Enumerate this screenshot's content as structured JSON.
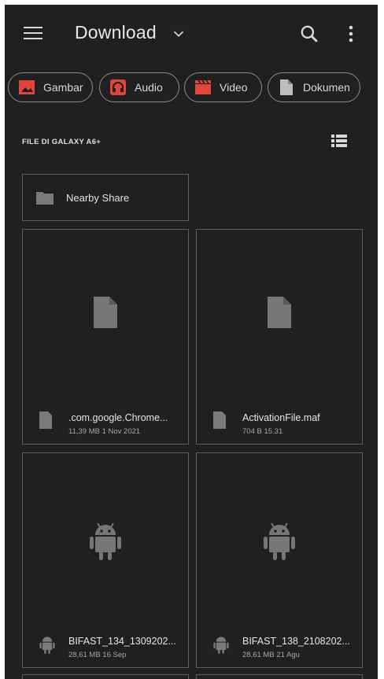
{
  "header": {
    "title": "Download"
  },
  "chips": [
    {
      "label": "Gambar",
      "icon": "image-icon"
    },
    {
      "label": "Audio",
      "icon": "headphones-icon"
    },
    {
      "label": "Video",
      "icon": "clapperboard-icon"
    },
    {
      "label": "Dokumen",
      "icon": "document-icon"
    }
  ],
  "section": {
    "label": "FILE DI GALAXY A6+"
  },
  "nearby": {
    "label": "Nearby Share"
  },
  "files": [
    {
      "name": ".com.google.Chrome...",
      "meta": "11,39 MB  1 Nov 2021",
      "type": "document"
    },
    {
      "name": "ActivationFile.maf",
      "meta": "704 B  15.31",
      "type": "document"
    },
    {
      "name": "BIFAST_134_1309202...",
      "meta": "28,61 MB  16 Sep",
      "type": "android"
    },
    {
      "name": "BIFAST_138_2108202...",
      "meta": "28,61 MB  21 Agu",
      "type": "android"
    }
  ],
  "colors": {
    "background": "#202020",
    "chip_icon": "#e0463c",
    "icon_gray": "#777777"
  }
}
